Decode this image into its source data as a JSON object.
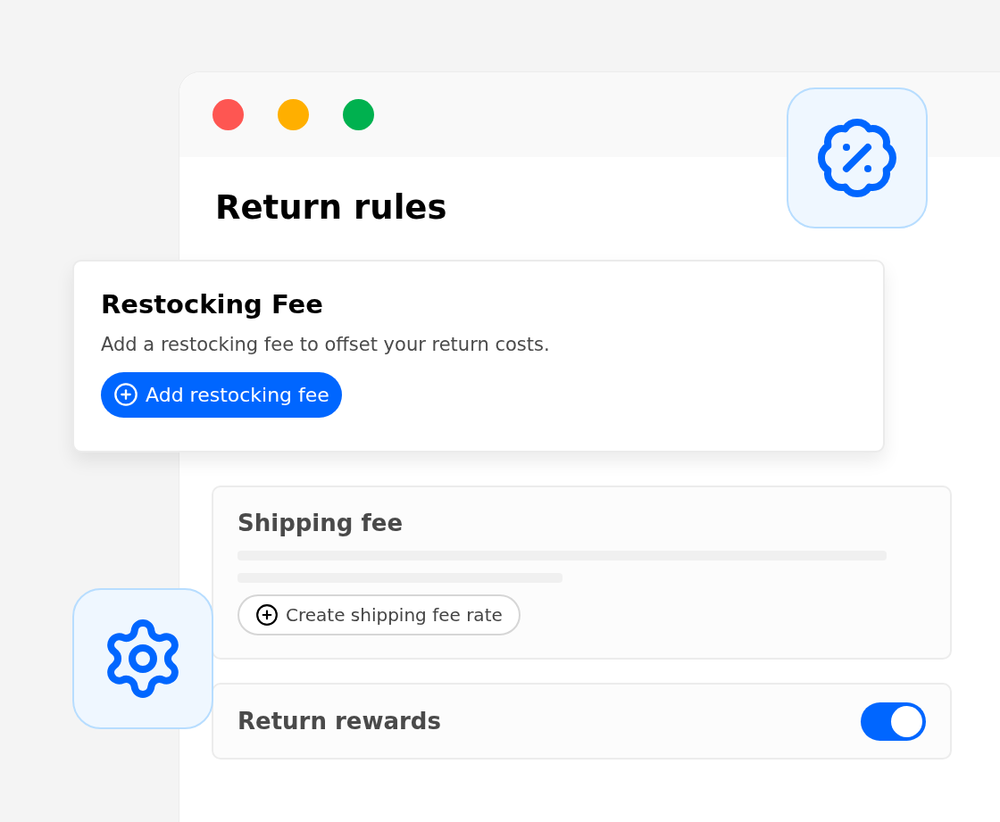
{
  "window": {
    "controls": [
      {
        "color": "#fe5652"
      },
      {
        "color": "#ffaf00"
      },
      {
        "color": "#00b14f"
      }
    ],
    "title": "Return rules"
  },
  "restocking_card": {
    "title": "Restocking Fee",
    "description": "Add a restocking fee to offset your return costs.",
    "button": "Add restocking fee"
  },
  "shipping_card": {
    "title": "Shipping fee",
    "button": "Create shipping fee rate"
  },
  "rewards_card": {
    "title": "Return rewards",
    "toggle": {
      "on": true
    }
  }
}
